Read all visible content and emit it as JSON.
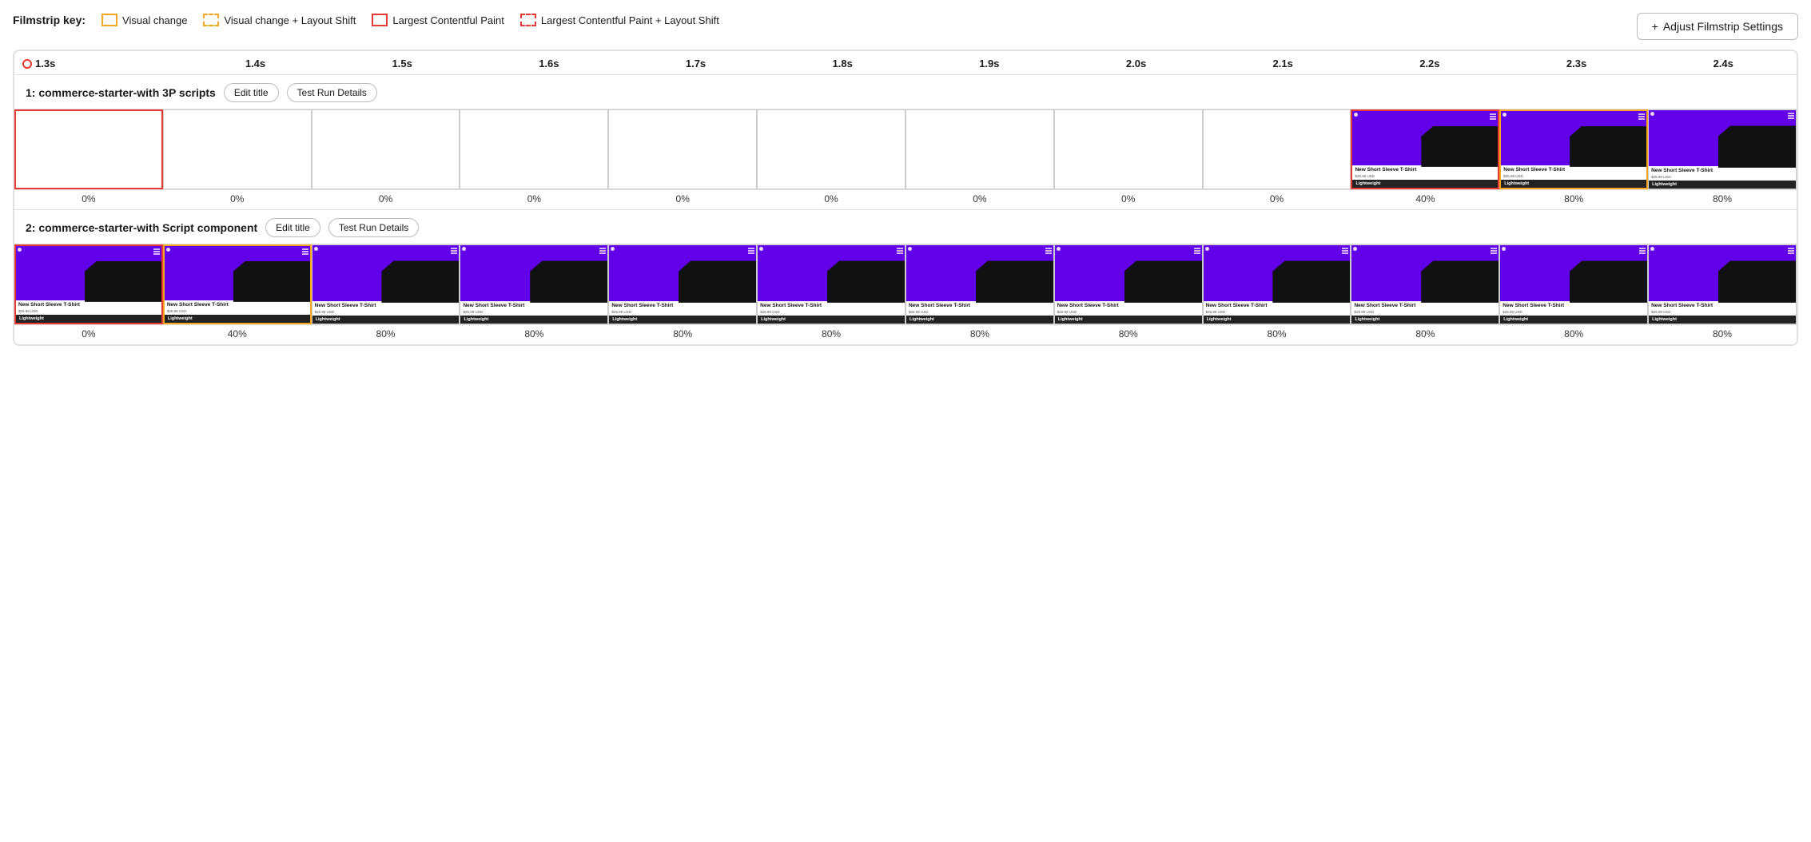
{
  "legend": {
    "label": "Filmstrip key:",
    "items": [
      {
        "id": "visual-change",
        "label": "Visual change",
        "borderStyle": "solid",
        "borderColor": "#f5a623"
      },
      {
        "id": "visual-change-layout-shift",
        "label": "Visual change + Layout Shift",
        "borderStyle": "dashed",
        "borderColor": "#f5a623"
      },
      {
        "id": "lcp",
        "label": "Largest Contentful Paint",
        "borderStyle": "solid",
        "borderColor": "#e53935"
      },
      {
        "id": "lcp-layout-shift",
        "label": "Largest Contentful Paint + Layout Shift",
        "borderStyle": "dashed",
        "borderColor": "#e53935"
      }
    ]
  },
  "adjustBtn": {
    "label": "Adjust Filmstrip Settings",
    "plus": "+"
  },
  "timeline": {
    "ticks": [
      "1.3s",
      "1.4s",
      "1.5s",
      "1.6s",
      "1.7s",
      "1.8s",
      "1.9s",
      "2.0s",
      "2.1s",
      "2.2s",
      "2.3s",
      "2.4s"
    ]
  },
  "rows": [
    {
      "id": "row1",
      "title": "1: commerce-starter-with 3P scripts",
      "editLabel": "Edit title",
      "detailsLabel": "Test Run Details",
      "frames": [
        {
          "id": "f1-1",
          "type": "empty",
          "pct": "0%",
          "border": "red-solid"
        },
        {
          "id": "f1-2",
          "type": "empty",
          "pct": "0%",
          "border": "none"
        },
        {
          "id": "f1-3",
          "type": "empty",
          "pct": "0%",
          "border": "none"
        },
        {
          "id": "f1-4",
          "type": "empty",
          "pct": "0%",
          "border": "none"
        },
        {
          "id": "f1-5",
          "type": "empty",
          "pct": "0%",
          "border": "none"
        },
        {
          "id": "f1-6",
          "type": "empty",
          "pct": "0%",
          "border": "none"
        },
        {
          "id": "f1-7",
          "type": "empty",
          "pct": "0%",
          "border": "none"
        },
        {
          "id": "f1-8",
          "type": "empty",
          "pct": "0%",
          "border": "none"
        },
        {
          "id": "f1-9",
          "type": "empty",
          "pct": "0%",
          "border": "none"
        },
        {
          "id": "f1-10",
          "type": "product",
          "pct": "40%",
          "border": "red-solid"
        },
        {
          "id": "f1-11",
          "type": "product",
          "pct": "80%",
          "border": "yellow-solid"
        },
        {
          "id": "f1-12",
          "type": "product",
          "pct": "80%",
          "border": "none"
        }
      ]
    },
    {
      "id": "row2",
      "title": "2: commerce-starter-with Script component",
      "editLabel": "Edit title",
      "detailsLabel": "Test Run Details",
      "frames": [
        {
          "id": "f2-1",
          "type": "product",
          "pct": "0%",
          "border": "red-solid"
        },
        {
          "id": "f2-2",
          "type": "product",
          "pct": "40%",
          "border": "yellow-solid"
        },
        {
          "id": "f2-3",
          "type": "product",
          "pct": "80%",
          "border": "none"
        },
        {
          "id": "f2-4",
          "type": "product",
          "pct": "80%",
          "border": "none"
        },
        {
          "id": "f2-5",
          "type": "product",
          "pct": "80%",
          "border": "none"
        },
        {
          "id": "f2-6",
          "type": "product",
          "pct": "80%",
          "border": "none"
        },
        {
          "id": "f2-7",
          "type": "product",
          "pct": "80%",
          "border": "none"
        },
        {
          "id": "f2-8",
          "type": "product",
          "pct": "80%",
          "border": "none"
        },
        {
          "id": "f2-9",
          "type": "product",
          "pct": "80%",
          "border": "none"
        },
        {
          "id": "f2-10",
          "type": "product",
          "pct": "80%",
          "border": "none"
        },
        {
          "id": "f2-11",
          "type": "product",
          "pct": "80%",
          "border": "none"
        },
        {
          "id": "f2-12",
          "type": "product",
          "pct": "80%",
          "border": "none"
        }
      ]
    }
  ],
  "product": {
    "title": "New Short Sleeve T-Shirt",
    "price": "$25.99 USD",
    "label": "Lightweight"
  }
}
